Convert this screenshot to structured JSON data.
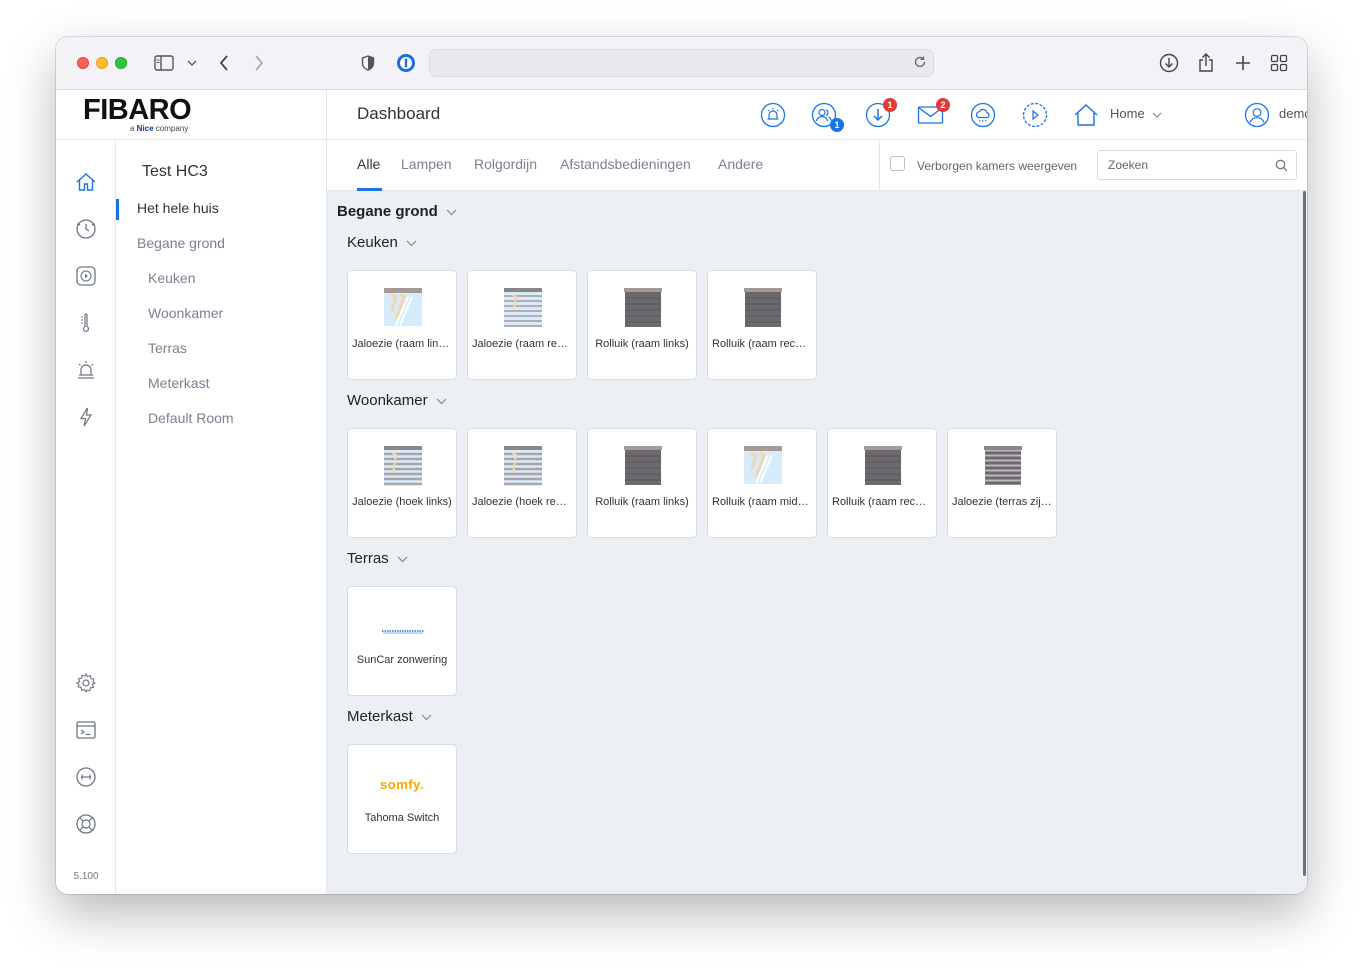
{
  "brand": {
    "logo": "FIBARO",
    "sub_prefix": "a ",
    "sub_brand": "Nice",
    "sub_suffix": " company"
  },
  "header": {
    "title": "Dashboard",
    "users_badge": "1",
    "updates_badge": "1",
    "messages_badge": "2",
    "location": "Home",
    "user": "demo"
  },
  "sidebar": {
    "house": "Test HC3",
    "items": [
      {
        "label": "Het hele huis",
        "active": true
      },
      {
        "label": "Begane grond"
      },
      {
        "label": "Keuken"
      },
      {
        "label": "Woonkamer"
      },
      {
        "label": "Terras"
      },
      {
        "label": "Meterkast"
      },
      {
        "label": "Default Room"
      }
    ]
  },
  "rail": {
    "version": "5.100"
  },
  "tabs": [
    {
      "label": "Alle",
      "active": true
    },
    {
      "label": "Lampen"
    },
    {
      "label": "Rolgordijn"
    },
    {
      "label": "Afstandsbedieningen"
    },
    {
      "label": "Andere"
    }
  ],
  "filters": {
    "hidden_rooms_label": "Verborgen kamers weergeven",
    "search_placeholder": "Zoeken"
  },
  "content": {
    "floor": "Begane grond",
    "rooms": [
      {
        "name": "Keuken",
        "devices": [
          {
            "label": "Jaloezie (raam links)",
            "icon": "blind-open-icon"
          },
          {
            "label": "Jaloezie (raam rechts)",
            "icon": "blind-slats-icon"
          },
          {
            "label": "Rolluik (raam links)",
            "icon": "shutter-closed-icon"
          },
          {
            "label": "Rolluik (raam rechts)",
            "icon": "shutter-closed-icon"
          }
        ]
      },
      {
        "name": "Woonkamer",
        "devices": [
          {
            "label": "Jaloezie (hoek links)",
            "icon": "blind-slats-icon"
          },
          {
            "label": "Jaloezie (hoek rechts)",
            "icon": "blind-slats-icon"
          },
          {
            "label": "Rolluik (raam links)",
            "icon": "shutter-closed-icon"
          },
          {
            "label": "Rolluik (raam midden)",
            "icon": "blind-open-icon"
          },
          {
            "label": "Rolluik (raam rechts)",
            "icon": "shutter-closed-icon"
          },
          {
            "label": "Jaloezie (terras zijkant)",
            "icon": "blind-dark-slats-icon"
          }
        ]
      },
      {
        "name": "Terras",
        "devices": [
          {
            "label": "SunCar zonwering",
            "icon": "awning-icon"
          }
        ]
      },
      {
        "name": "Meterkast",
        "devices": [
          {
            "label": "Tahoma Switch",
            "icon": "somfy-logo",
            "logo_text": "somfy."
          }
        ]
      }
    ]
  },
  "colors": {
    "accent": "#1a73e8",
    "badge_red": "#e53935",
    "shutter": "#6b686e",
    "somfy": "#f6a800"
  }
}
